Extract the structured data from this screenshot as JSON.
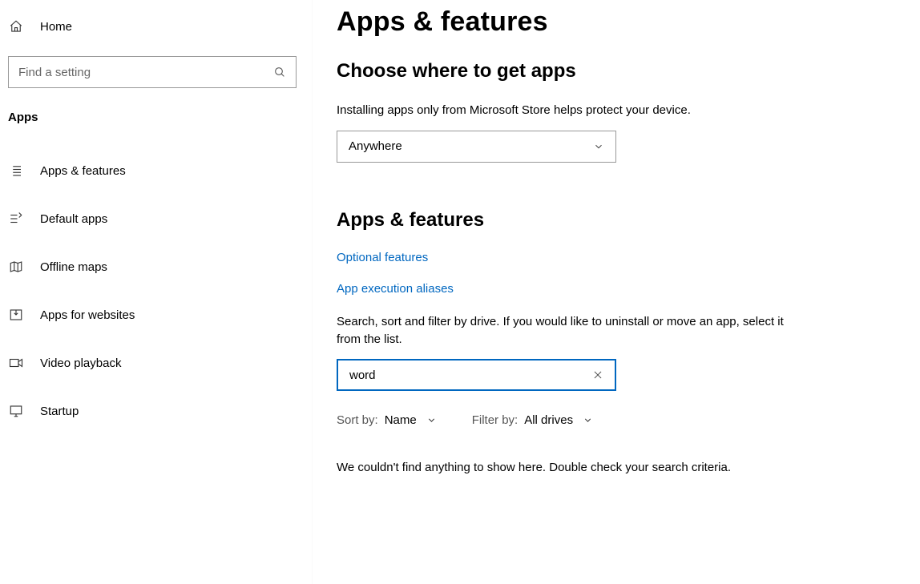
{
  "sidebar": {
    "home_label": "Home",
    "search_placeholder": "Find a setting",
    "section_label": "Apps",
    "items": [
      {
        "label": "Apps & features"
      },
      {
        "label": "Default apps"
      },
      {
        "label": "Offline maps"
      },
      {
        "label": "Apps for websites"
      },
      {
        "label": "Video playback"
      },
      {
        "label": "Startup"
      }
    ]
  },
  "main": {
    "title": "Apps & features",
    "choose_heading": "Choose where to get apps",
    "choose_text": "Installing apps only from Microsoft Store helps protect your device.",
    "source_dropdown_value": "Anywhere",
    "apps_heading": "Apps & features",
    "optional_link": "Optional features",
    "aliases_link": "App execution aliases",
    "search_hint": "Search, sort and filter by drive. If you would like to uninstall or move an app, select it from the list.",
    "search_value": "word",
    "sort_label": "Sort by:",
    "sort_value": "Name",
    "filter_label": "Filter by:",
    "filter_value": "All drives",
    "empty_message": "We couldn't find anything to show here. Double check your search criteria."
  }
}
